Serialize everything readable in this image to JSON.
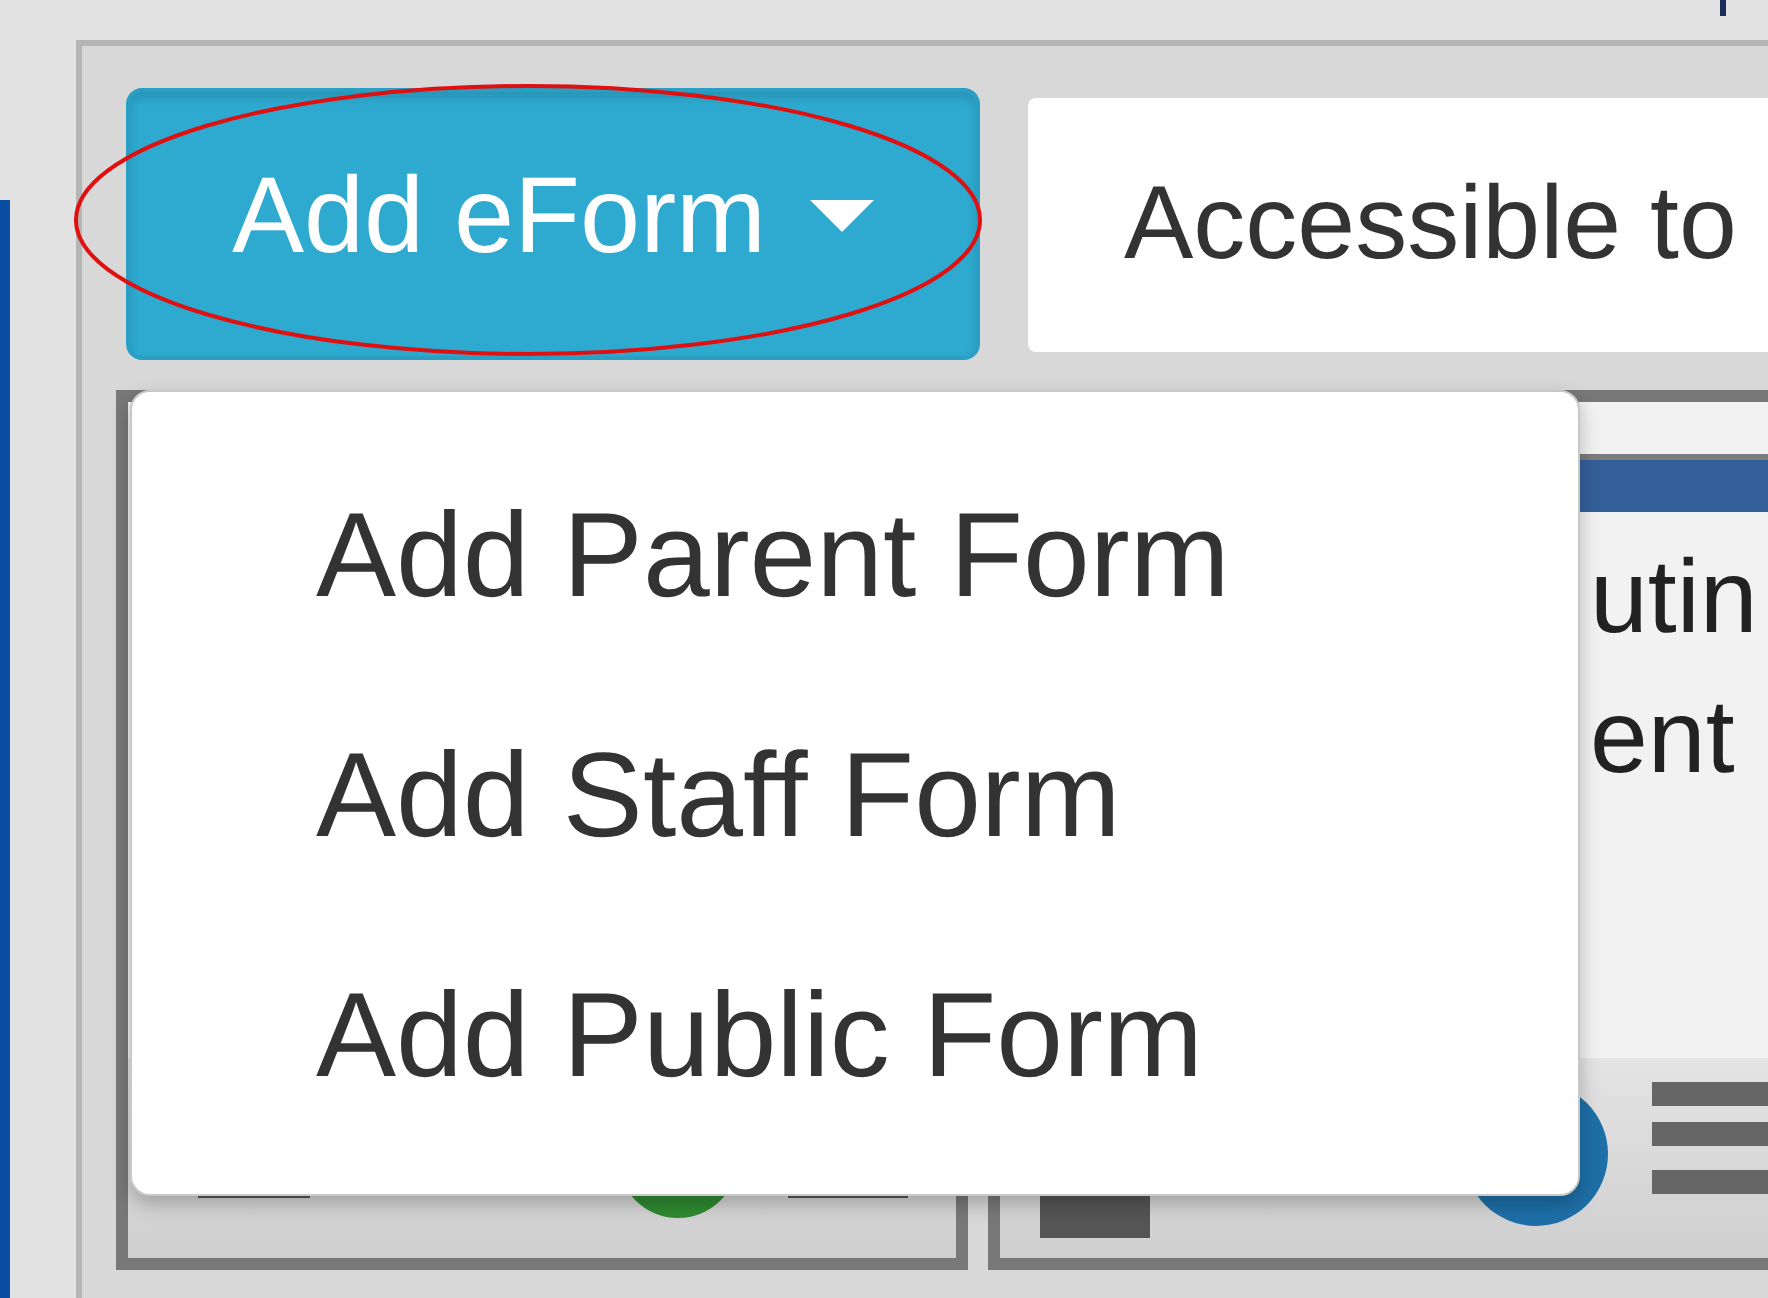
{
  "toolbar": {
    "add_button": {
      "label": "Add eForm",
      "expanded": true
    },
    "filter": {
      "text": "Accessible to"
    }
  },
  "menu": [
    {
      "label": "Add Parent Form"
    },
    {
      "label": "Add Staff Form"
    },
    {
      "label": "Add Public Form"
    }
  ],
  "right_card": {
    "lines": [
      "utin",
      "ent"
    ]
  }
}
